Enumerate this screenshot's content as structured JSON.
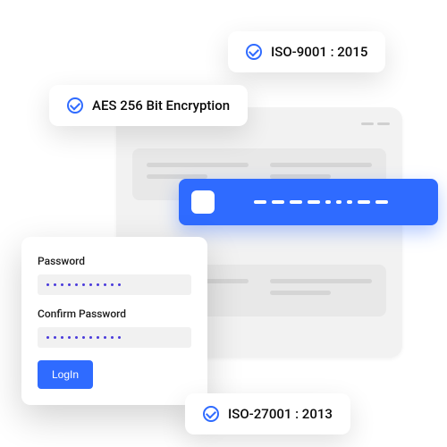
{
  "badges": {
    "iso9001": "ISO-9001 : 2015",
    "aes": "AES 256 Bit Encryption",
    "iso27001": "ISO-27001 : 2013"
  },
  "login": {
    "password_label": "Password",
    "confirm_label": "Confirm Password",
    "button": "LogIn"
  }
}
